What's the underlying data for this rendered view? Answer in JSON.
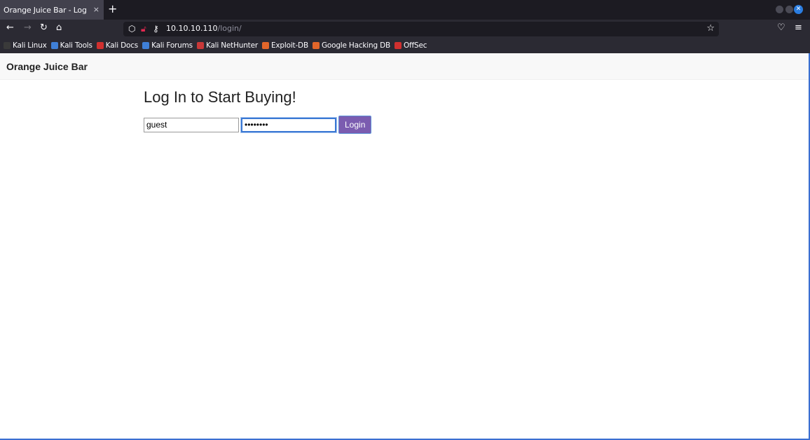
{
  "browser": {
    "tab_title": "Orange Juice Bar - Log In",
    "tab_close": "×",
    "new_tab": "+",
    "url_host": "10.10.10.110",
    "url_path": "/login/",
    "bookmarks": [
      {
        "label": "Kali Linux",
        "color": "#3a3a3a"
      },
      {
        "label": "Kali Tools",
        "color": "#3f7fd6"
      },
      {
        "label": "Kali Docs",
        "color": "#d0302f"
      },
      {
        "label": "Kali Forums",
        "color": "#3f7fd6"
      },
      {
        "label": "Kali NetHunter",
        "color": "#c83838"
      },
      {
        "label": "Exploit-DB",
        "color": "#e2662a"
      },
      {
        "label": "Google Hacking DB",
        "color": "#e2662a"
      },
      {
        "label": "OffSec",
        "color": "#d0302f"
      }
    ]
  },
  "site": {
    "brand": "Orange Juice Bar",
    "heading": "Log In to Start Buying!",
    "username_value": "guest",
    "password_value": "********",
    "login_label": "Login"
  },
  "colors": {
    "button_bg": "#7b5cb0",
    "focus_border": "#3a78d4"
  }
}
